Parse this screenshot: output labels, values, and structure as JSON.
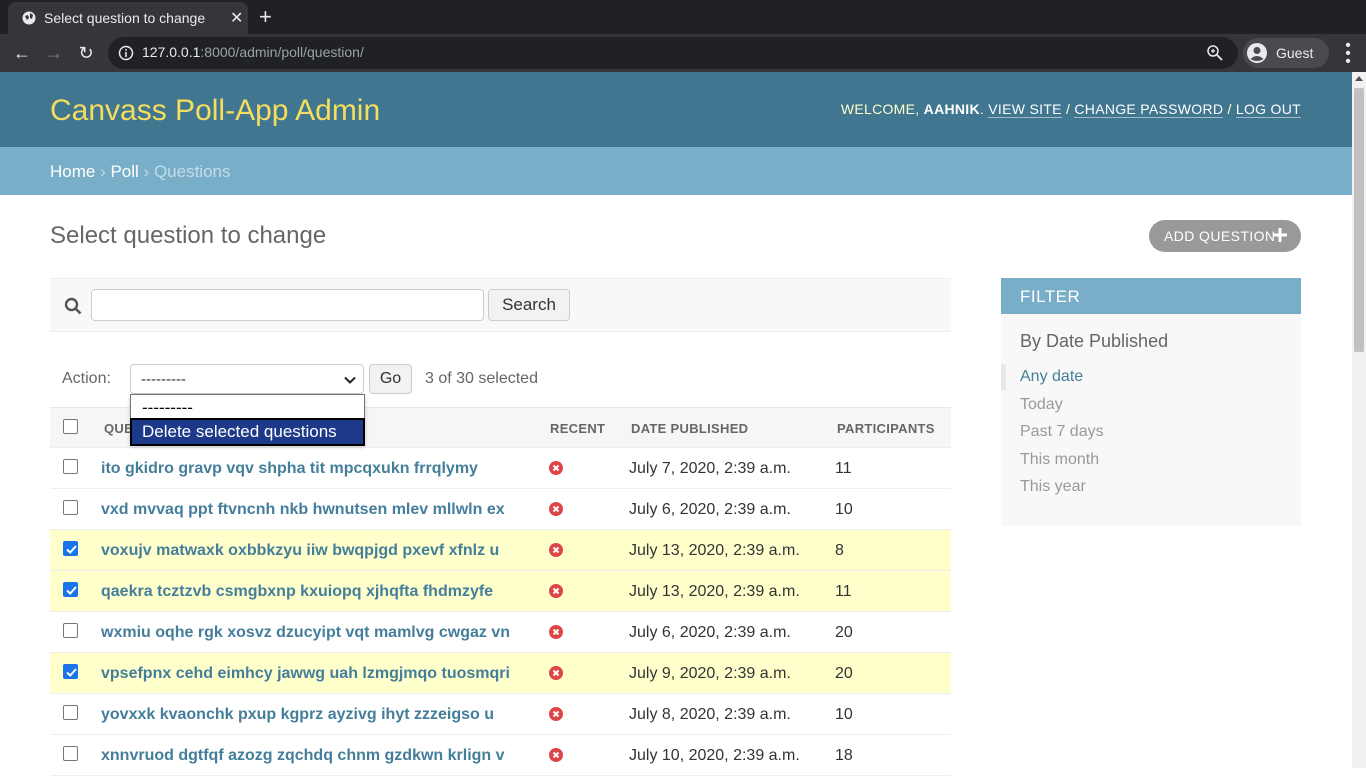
{
  "browser": {
    "tab_title": "Select question to change",
    "url_host": "127.0.0.1",
    "url_rest": ":8000/admin/poll/question/",
    "profile_name": "Guest"
  },
  "header": {
    "brand": "Canvass Poll-App Admin",
    "welcome": "WELCOME, ",
    "username": "AAHNIK",
    "view_site": "VIEW SITE",
    "change_password": "CHANGE PASSWORD",
    "log_out": "LOG OUT"
  },
  "breadcrumbs": {
    "home": "Home",
    "app": "Poll",
    "current": "Questions"
  },
  "page": {
    "title": "Select question to change",
    "add_button": "ADD QUESTION"
  },
  "search": {
    "value": "",
    "button": "Search"
  },
  "actions": {
    "label": "Action:",
    "selected": "---------",
    "go": "Go",
    "counter": "3 of 30 selected",
    "options": [
      "---------",
      "Delete selected questions"
    ],
    "highlighted": "Delete selected questions"
  },
  "table": {
    "columns": [
      "QUESTION",
      "RECENT",
      "DATE PUBLISHED",
      "PARTICIPANTS"
    ],
    "rows": [
      {
        "text": "ito gkidro gravp vqv shpha tit mpcqxukn frrqlymy",
        "date": "July 7, 2020, 2:39 a.m.",
        "participants": "11",
        "selected": false
      },
      {
        "text": "vxd mvvaq ppt ftvncnh nkb hwnutsen mlev mllwln ex",
        "date": "July 6, 2020, 2:39 a.m.",
        "participants": "10",
        "selected": false
      },
      {
        "text": "voxujv matwaxk oxbbkzyu iiw bwqpjgd pxevf xfnlz u",
        "date": "July 13, 2020, 2:39 a.m.",
        "participants": "8",
        "selected": true
      },
      {
        "text": "qaekra tcztzvb csmgbxnp kxuiopq xjhqfta fhdmzyfe",
        "date": "July 13, 2020, 2:39 a.m.",
        "participants": "11",
        "selected": true
      },
      {
        "text": "wxmiu oqhe rgk xosvz dzucyipt vqt mamlvg cwgaz vn",
        "date": "July 6, 2020, 2:39 a.m.",
        "participants": "20",
        "selected": false
      },
      {
        "text": "vpsefpnx cehd eimhcy jawwg uah lzmgjmqo tuosmqri",
        "date": "July 9, 2020, 2:39 a.m.",
        "participants": "20",
        "selected": true
      },
      {
        "text": "yovxxk kvaonchk pxup kgprz ayzivg ihyt zzzeigso u",
        "date": "July 8, 2020, 2:39 a.m.",
        "participants": "10",
        "selected": false
      },
      {
        "text": "xnnvruod dgtfqf azozg zqchdq chnm gzdkwn krlign v",
        "date": "July 10, 2020, 2:39 a.m.",
        "participants": "18",
        "selected": false
      }
    ]
  },
  "filter": {
    "title": "FILTER",
    "subtitle": "By Date Published",
    "items": [
      "Any date",
      "Today",
      "Past 7 days",
      "This month",
      "This year"
    ],
    "active": "Any date"
  },
  "colors": {
    "header_bg": "#417690",
    "brand": "#f5dd5d",
    "breadcrumb_bg": "#79aec8",
    "link": "#447e9b",
    "selected_row": "#ffffcc",
    "recent_false_icon": "#dd4646"
  }
}
